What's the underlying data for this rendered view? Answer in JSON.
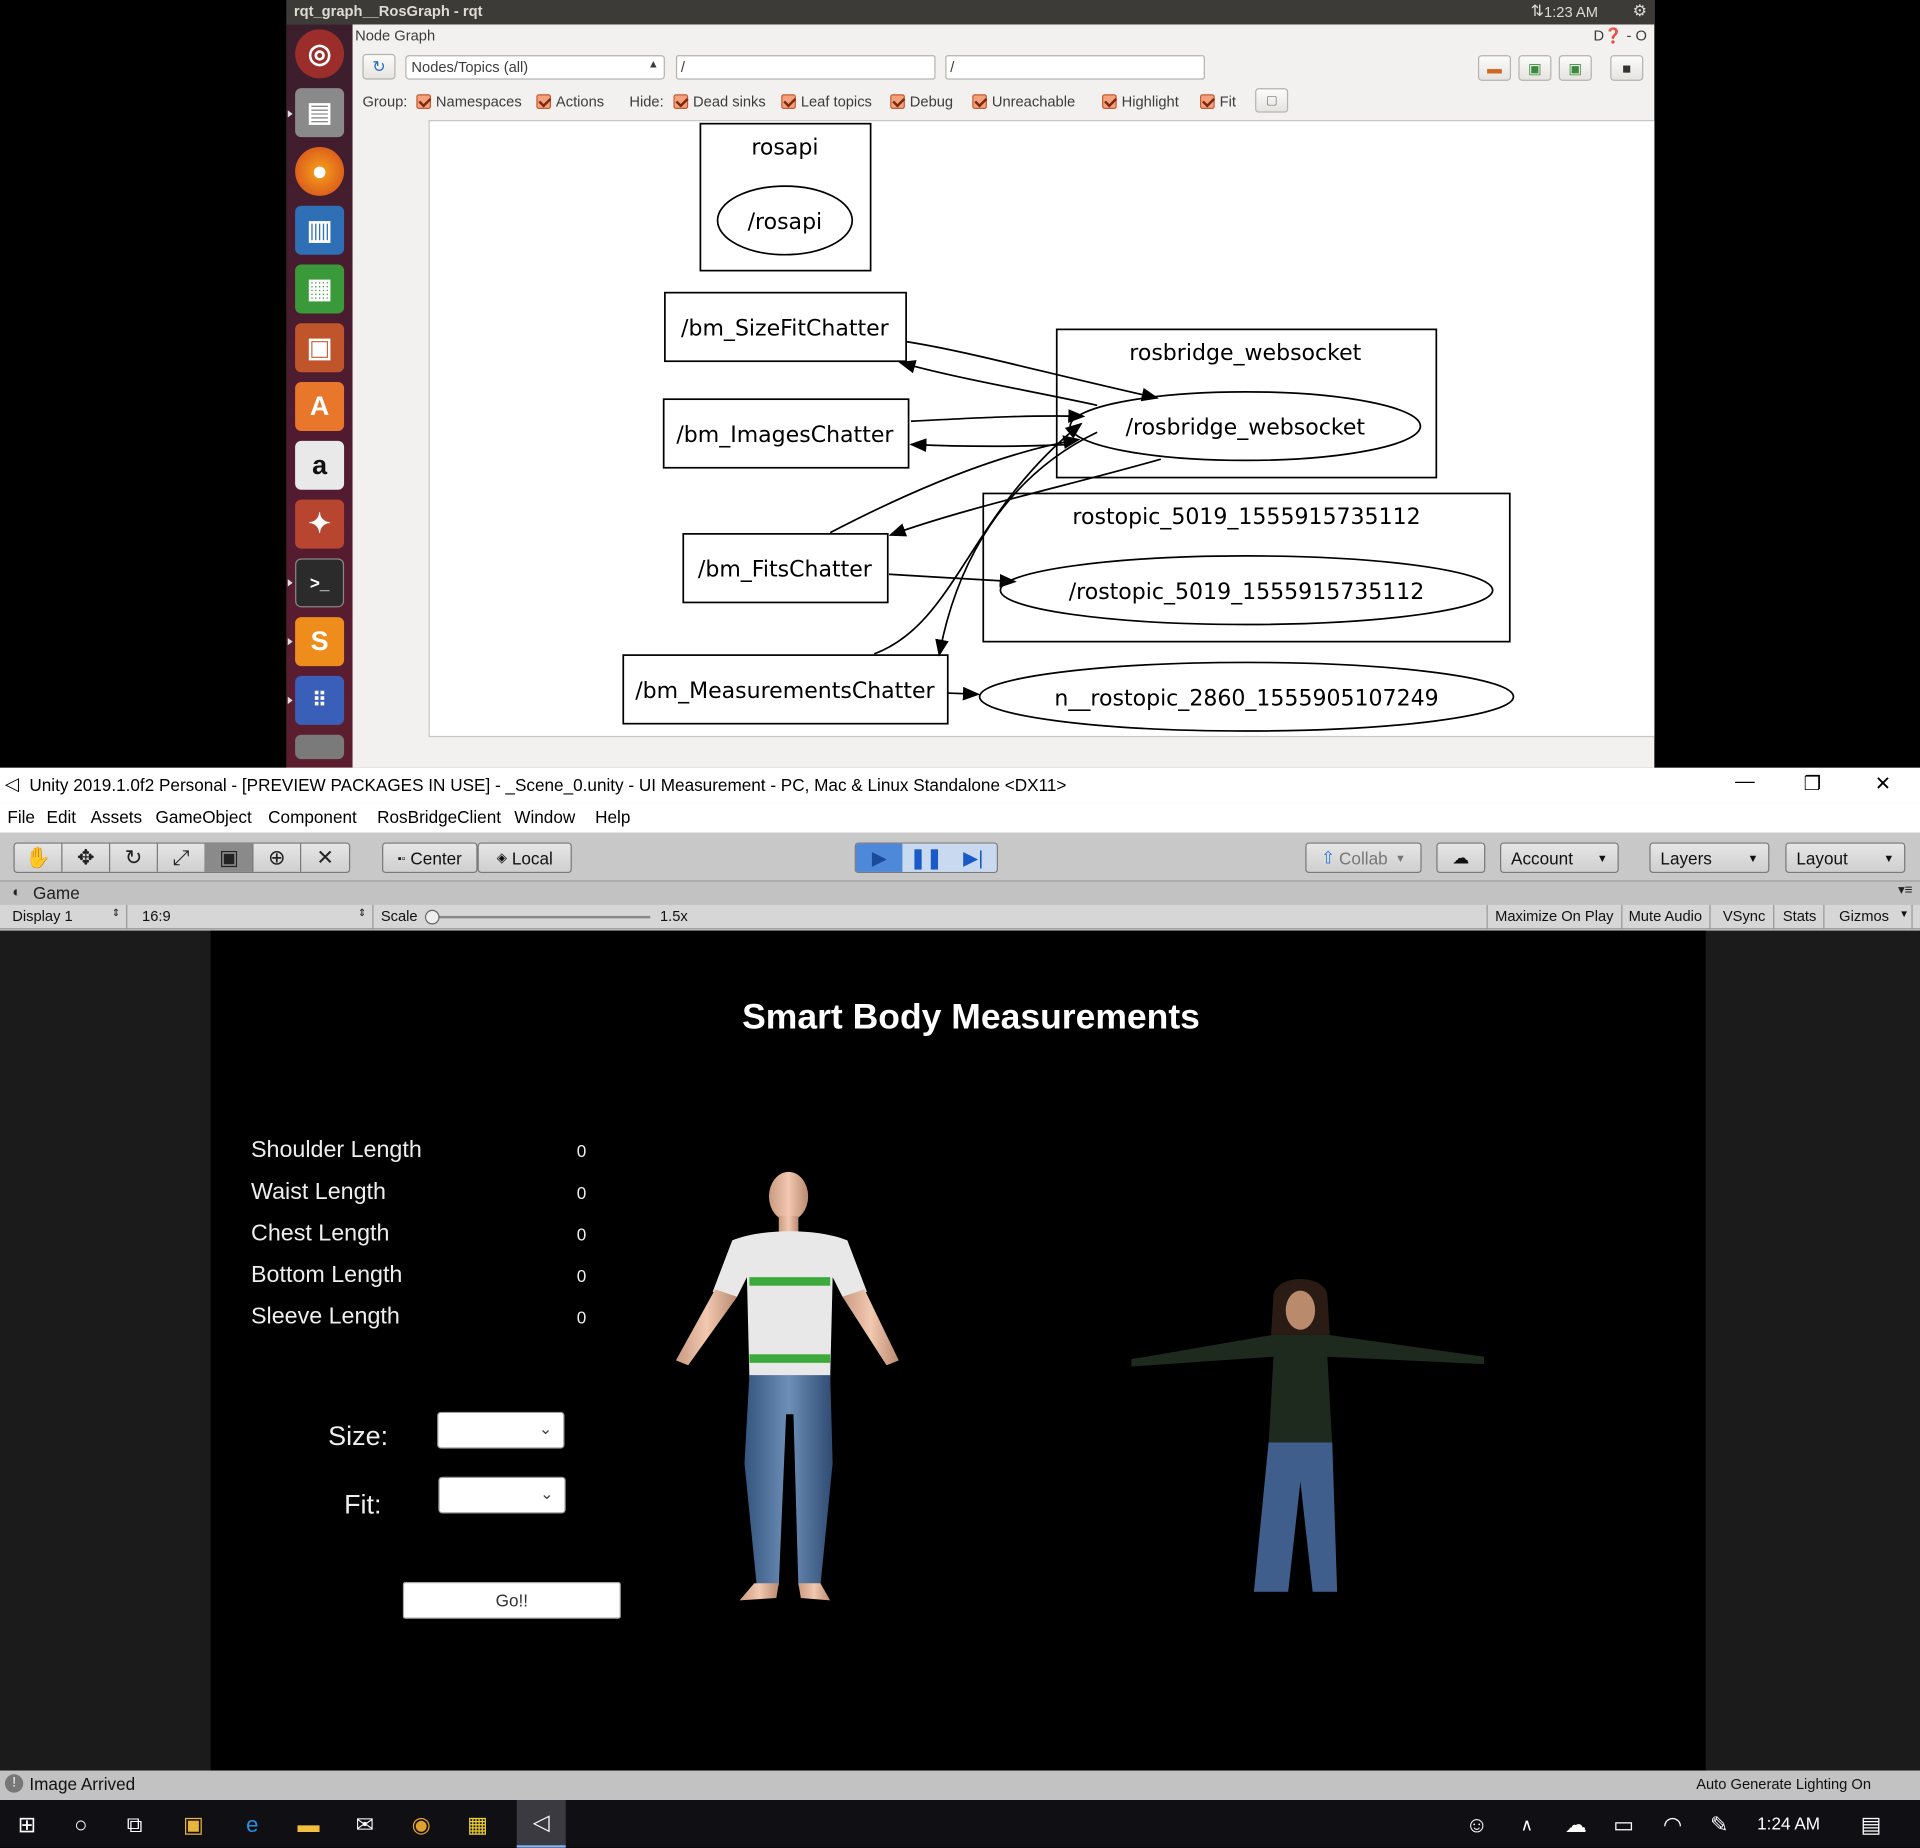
{
  "ubuntu": {
    "window_title": "rqt_graph__RosGraph - rqt",
    "clock": "1:23 AM",
    "launcher": [
      "ubuntu-dash-icon",
      "files-icon",
      "firefox-icon",
      "writer-icon",
      "calc-icon",
      "impress-icon",
      "software-center-icon",
      "amazon-icon",
      "settings-icon",
      "terminal-icon",
      "sublime-icon",
      "workspaces-icon",
      "trash-icon"
    ]
  },
  "rqt": {
    "plugin_title": "Node Graph",
    "plugin_controls": "D❓ - O",
    "view_mode": "Nodes/Topics (all)",
    "filter_1": "/",
    "filter_2": "/",
    "group_label": "Group:",
    "hide_label": "Hide:",
    "checkboxes": {
      "namespaces": "Namespaces",
      "actions": "Actions",
      "dead_sinks": "Dead sinks",
      "leaf_topics": "Leaf topics",
      "debug": "Debug",
      "unreachable": "Unreachable",
      "highlight": "Highlight",
      "fit": "Fit"
    },
    "graph": {
      "ns_rosapi": "rosapi",
      "node_rosapi": "/rosapi",
      "topic_sizefit": "/bm_SizeFitChatter",
      "topic_images": "/bm_ImagesChatter",
      "topic_fits": "/bm_FitsChatter",
      "topic_measurements": "/bm_MeasurementsChatter",
      "ns_rosbridge": "rosbridge_websocket",
      "node_rosbridge": "/rosbridge_websocket",
      "ns_rostopic": "rostopic_5019_1555915735112",
      "node_rostopic": "/rostopic_5019_1555915735112",
      "node_n_rostopic": "n__rostopic_2860_1555905107249"
    }
  },
  "unity": {
    "title": "Unity 2019.1.0f2 Personal - [PREVIEW PACKAGES IN USE] - _Scene_0.unity - UI Measurement - PC, Mac & Linux Standalone <DX11>",
    "menu": [
      "File",
      "Edit",
      "Assets",
      "GameObject",
      "Component",
      "RosBridgeClient",
      "Window",
      "Help"
    ],
    "pivot_center": "Center",
    "pivot_local": "Local",
    "collab": "Collab",
    "account": "Account",
    "layers": "Layers",
    "layout": "Layout",
    "game_tab": "Game",
    "display": "Display 1",
    "aspect": "16:9",
    "scale_label": "Scale",
    "scale_value": "1.5x",
    "scale_fraction": 0.0,
    "maximize_on_play": "Maximize On Play",
    "mute_audio": "Mute Audio",
    "vsync": "VSync",
    "stats": "Stats",
    "gizmos": "Gizmos",
    "status_message": "Image Arrived",
    "lighting_status": "Auto Generate Lighting On"
  },
  "game": {
    "heading": "Smart Body Measurements",
    "measurements": [
      {
        "label": "Shoulder Length",
        "value": "0"
      },
      {
        "label": "Waist Length",
        "value": "0"
      },
      {
        "label": "Chest Length",
        "value": "0"
      },
      {
        "label": "Bottom Length",
        "value": "0"
      },
      {
        "label": "Sleeve Length",
        "value": "0"
      }
    ],
    "size_label": "Size:",
    "fit_label": "Fit:",
    "size_value": "",
    "fit_value": "",
    "go_button": "Go!!"
  },
  "taskbar": {
    "clock": "1:24 AM"
  }
}
